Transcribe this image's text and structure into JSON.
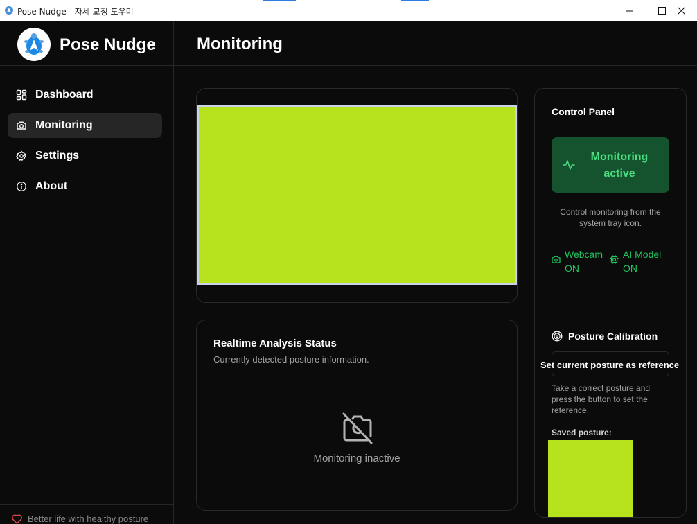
{
  "window": {
    "title": "Pose Nudge - 자세 교정 도우미",
    "minimize_icon": "minimize-icon",
    "maximize_icon": "maximize-icon",
    "close_icon": "close-icon"
  },
  "sidebar": {
    "brand": "Pose Nudge",
    "logo_icon": "turtle-logo-icon",
    "items": [
      {
        "label": "Dashboard",
        "icon": "dashboard-icon",
        "active": false
      },
      {
        "label": "Monitoring",
        "icon": "camera-icon",
        "active": true
      },
      {
        "label": "Settings",
        "icon": "gear-icon",
        "active": false
      },
      {
        "label": "About",
        "icon": "info-icon",
        "active": false
      }
    ],
    "footer": "Better life with healthy posture"
  },
  "header": {
    "title": "Monitoring"
  },
  "video": {
    "frame_color": "#b6e31e"
  },
  "status": {
    "title": "Realtime Analysis Status",
    "subtitle": "Currently detected posture information.",
    "inactive_text": "Monitoring inactive",
    "icon": "camera-off-icon"
  },
  "control_panel": {
    "title": "Control Panel",
    "monitor_button": "Monitoring active",
    "help": "Control monitoring from the system tray icon.",
    "webcam": "Webcam ON",
    "ai_model": "AI Model ON"
  },
  "calibration": {
    "title": "Posture Calibration",
    "button": "Set current posture as reference",
    "help": "Take a correct posture and press the button to set the reference.",
    "saved_label": "Saved posture:"
  },
  "colors": {
    "accent_green": "#22c55e",
    "active_button_bg": "#14532d",
    "placeholder": "#b6e31e",
    "background": "#0b0b0b"
  }
}
